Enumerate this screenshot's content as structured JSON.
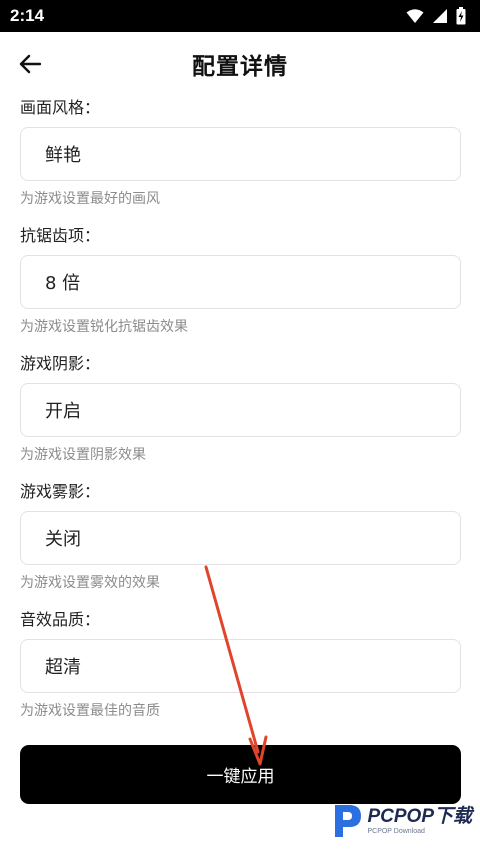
{
  "status_bar": {
    "time": "2:14"
  },
  "header": {
    "title": "配置详情"
  },
  "settings": [
    {
      "label": "画面风格：",
      "value": "鲜艳",
      "hint": "为游戏设置最好的画风"
    },
    {
      "label": "抗锯齿项：",
      "value": "8 倍",
      "hint": "为游戏设置锐化抗锯齿效果"
    },
    {
      "label": "游戏阴影：",
      "value": "开启",
      "hint": "为游戏设置阴影效果"
    },
    {
      "label": "游戏雾影：",
      "value": "关闭",
      "hint": "为游戏设置雾效的效果"
    },
    {
      "label": "音效品质：",
      "value": "超清",
      "hint": "为游戏设置最佳的音质"
    }
  ],
  "apply_button": {
    "label": "一键应用"
  },
  "watermark": {
    "main": "PCPOP下载",
    "sub": "PCPOP Download"
  },
  "colors": {
    "accent": "#000000",
    "annotation_arrow": "#e0452b",
    "hint_text": "#8c8c8c"
  }
}
